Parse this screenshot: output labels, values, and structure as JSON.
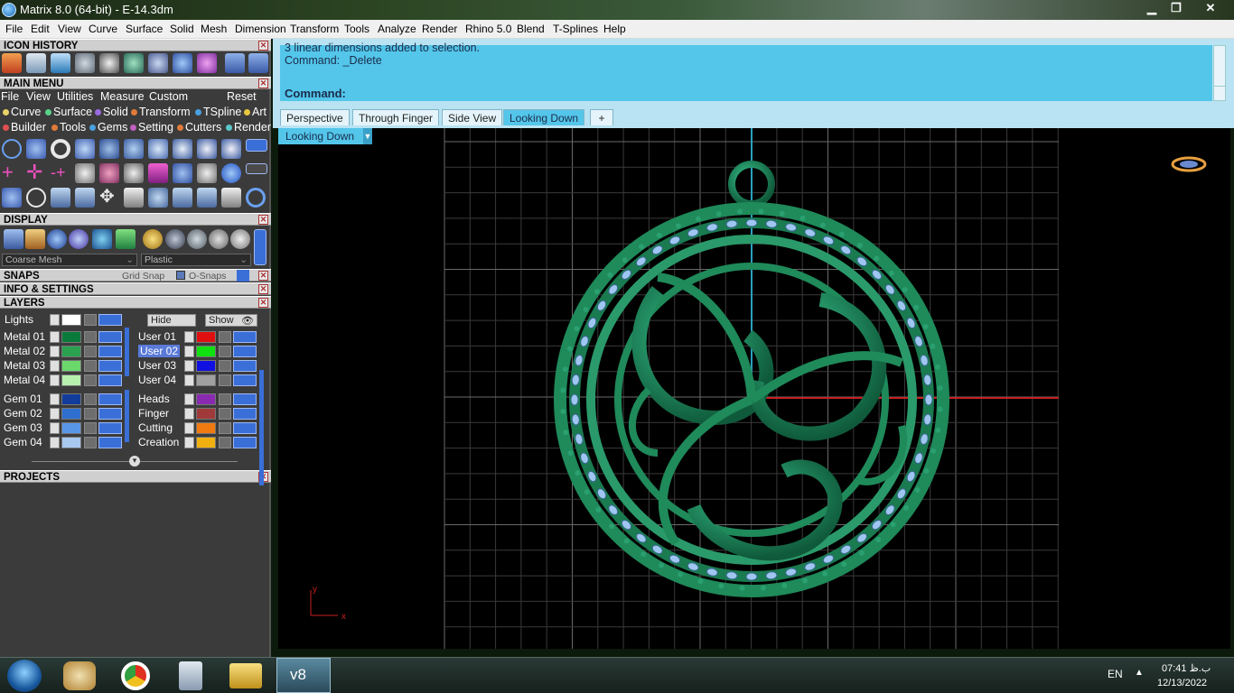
{
  "window": {
    "title": "Matrix 8.0 (64-bit) - E-14.3dm",
    "min": "▁",
    "max": "❐",
    "close": "✕"
  },
  "menubar": [
    "File",
    "Edit",
    "View",
    "Curve",
    "Surface",
    "Solid",
    "Mesh",
    "Dimension",
    "Transform",
    "Tools",
    "Analyze",
    "Render",
    "Rhino 5.0",
    "Blend",
    "T-Splines",
    "Help"
  ],
  "panels": {
    "icon_history": "ICON HISTORY",
    "main_menu": "MAIN MENU",
    "display": "DISPLAY",
    "snaps": "SNAPS",
    "info_settings": "INFO & SETTINGS",
    "layers": "LAYERS",
    "projects": "PROJECTS"
  },
  "main_menu_row1": [
    "File",
    "View",
    "Utilities",
    "Measure",
    "Custom"
  ],
  "main_menu_reset": "Reset",
  "main_menu_row2": [
    {
      "label": "Curve",
      "color": "#e8d36a"
    },
    {
      "label": "Surface",
      "color": "#5ad28a"
    },
    {
      "label": "Solid",
      "color": "#9a6ae0"
    },
    {
      "label": "Transform",
      "color": "#e07a3a"
    },
    {
      "label": "TSpline",
      "color": "#4aa0e0"
    },
    {
      "label": "Art",
      "color": "#e8c840"
    }
  ],
  "main_menu_row3": [
    {
      "label": "Builder",
      "color": "#e05050"
    },
    {
      "label": "Tools",
      "color": "#e07a3a"
    },
    {
      "label": "Gems",
      "color": "#4aa0e0"
    },
    {
      "label": "Setting",
      "color": "#c060c0"
    },
    {
      "label": "Cutters",
      "color": "#e07a3a"
    },
    {
      "label": "Render",
      "color": "#5ac8c8"
    }
  ],
  "display": {
    "mesh": "Coarse Mesh",
    "material": "Plastic"
  },
  "snaps": {
    "grid": "Grid Snap",
    "osnap": "O-Snaps"
  },
  "layers": {
    "lights": "Lights",
    "hide": "Hide",
    "show": "Show",
    "left": [
      {
        "name": "Metal 01",
        "color": "#0a7a3a"
      },
      {
        "name": "Metal 02",
        "color": "#2aa050"
      },
      {
        "name": "Metal 03",
        "color": "#6ad86a"
      },
      {
        "name": "Metal 04",
        "color": "#b8f0b0"
      },
      {
        "name": "Gem 01",
        "color": "#123c9a"
      },
      {
        "name": "Gem 02",
        "color": "#2f6fd0"
      },
      {
        "name": "Gem 03",
        "color": "#5a96e8"
      },
      {
        "name": "Gem 04",
        "color": "#a8c8f0"
      }
    ],
    "right": [
      {
        "name": "User 01",
        "color": "#e01010",
        "selected": false
      },
      {
        "name": "User 02",
        "color": "#10e010",
        "selected": true
      },
      {
        "name": "User 03",
        "color": "#1010e0",
        "selected": false
      },
      {
        "name": "User 04",
        "color": "#a0a0a0",
        "selected": false
      },
      {
        "name": "Heads",
        "color": "#8a2ab0",
        "selected": false
      },
      {
        "name": "Finger",
        "color": "#a03a3a",
        "selected": false
      },
      {
        "name": "Cutting",
        "color": "#f07a10",
        "selected": false
      },
      {
        "name": "Creation",
        "color": "#f0b010",
        "selected": false
      }
    ]
  },
  "command": {
    "history_line1": "3 linear dimensions added to selection.",
    "history_line2": "Command: _Delete",
    "prompt": "Command:"
  },
  "tabs": [
    {
      "label": "Perspective",
      "active": false
    },
    {
      "label": "Through Finger",
      "active": false
    },
    {
      "label": "Side View",
      "active": false
    },
    {
      "label": "Looking Down",
      "active": true
    }
  ],
  "add_tab": "+",
  "viewport": {
    "label": "Looking Down",
    "axis_x": "x",
    "axis_y": "y"
  },
  "taskbar": {
    "lang": "EN",
    "time": "07:41 ب.ظ",
    "date": "12/13/2022",
    "apps": [
      "start",
      "paint",
      "chrome",
      "calculator",
      "file-explorer",
      "matrix-v8"
    ],
    "active_app_label": "v8"
  },
  "colors": {
    "accent": "#53c6ea",
    "panel": "#3b3b3b",
    "model": "#1f8a5a",
    "gems": "#9ec6f0",
    "xaxis": "#c82020",
    "yaxis": "#2aa0c0"
  }
}
